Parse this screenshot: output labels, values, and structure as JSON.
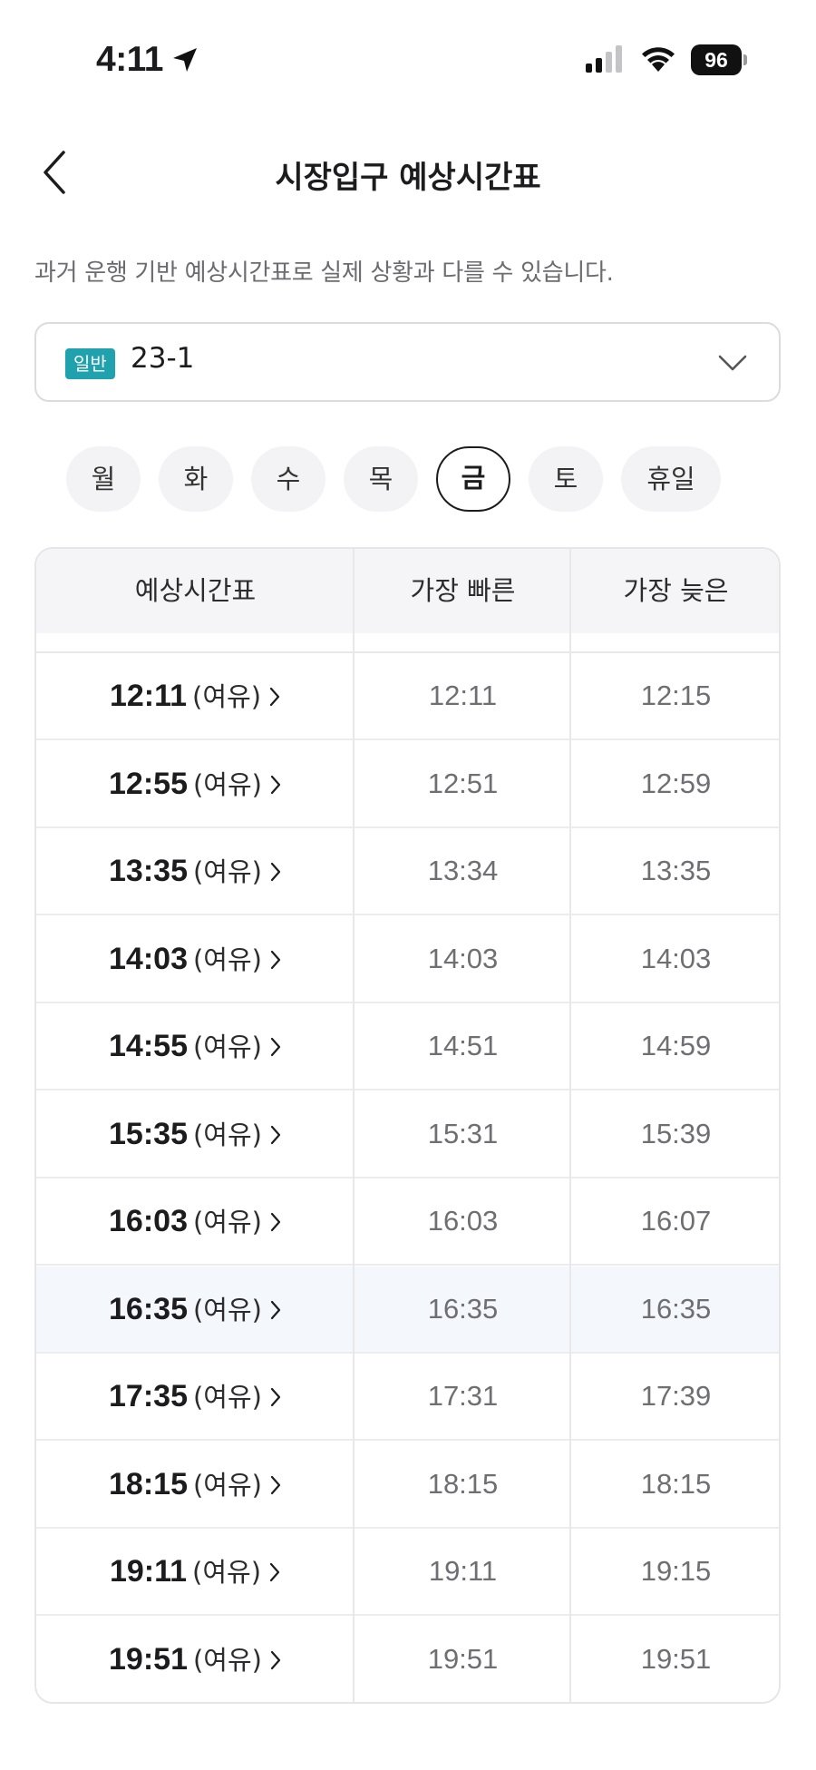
{
  "status_bar": {
    "time": "4:11",
    "battery": "96"
  },
  "header": {
    "title": "시장입구 예상시간표"
  },
  "notice": "과거 운행 기반 예상시간표로 실제 상황과 다를 수 있습니다.",
  "route": {
    "badge": "일반",
    "name": "23-1"
  },
  "day_tabs": [
    {
      "label": "월",
      "active": false
    },
    {
      "label": "화",
      "active": false
    },
    {
      "label": "수",
      "active": false
    },
    {
      "label": "목",
      "active": false
    },
    {
      "label": "금",
      "active": true
    },
    {
      "label": "토",
      "active": false
    },
    {
      "label": "휴일",
      "active": false
    }
  ],
  "table": {
    "headers": [
      "예상시간표",
      "가장 빠른",
      "가장 늦은"
    ],
    "rows": [
      {
        "time": "12:11",
        "status": "(여유)",
        "earliest": "12:11",
        "latest": "12:15",
        "highlight": false
      },
      {
        "time": "12:55",
        "status": "(여유)",
        "earliest": "12:51",
        "latest": "12:59",
        "highlight": false
      },
      {
        "time": "13:35",
        "status": "(여유)",
        "earliest": "13:34",
        "latest": "13:35",
        "highlight": false
      },
      {
        "time": "14:03",
        "status": "(여유)",
        "earliest": "14:03",
        "latest": "14:03",
        "highlight": false
      },
      {
        "time": "14:55",
        "status": "(여유)",
        "earliest": "14:51",
        "latest": "14:59",
        "highlight": false
      },
      {
        "time": "15:35",
        "status": "(여유)",
        "earliest": "15:31",
        "latest": "15:39",
        "highlight": false
      },
      {
        "time": "16:03",
        "status": "(여유)",
        "earliest": "16:03",
        "latest": "16:07",
        "highlight": false
      },
      {
        "time": "16:35",
        "status": "(여유)",
        "earliest": "16:35",
        "latest": "16:35",
        "highlight": true
      },
      {
        "time": "17:35",
        "status": "(여유)",
        "earliest": "17:31",
        "latest": "17:39",
        "highlight": false
      },
      {
        "time": "18:15",
        "status": "(여유)",
        "earliest": "18:15",
        "latest": "18:15",
        "highlight": false
      },
      {
        "time": "19:11",
        "status": "(여유)",
        "earliest": "19:11",
        "latest": "19:15",
        "highlight": false
      },
      {
        "time": "19:51",
        "status": "(여유)",
        "earliest": "19:51",
        "latest": "19:51",
        "highlight": false
      }
    ]
  }
}
